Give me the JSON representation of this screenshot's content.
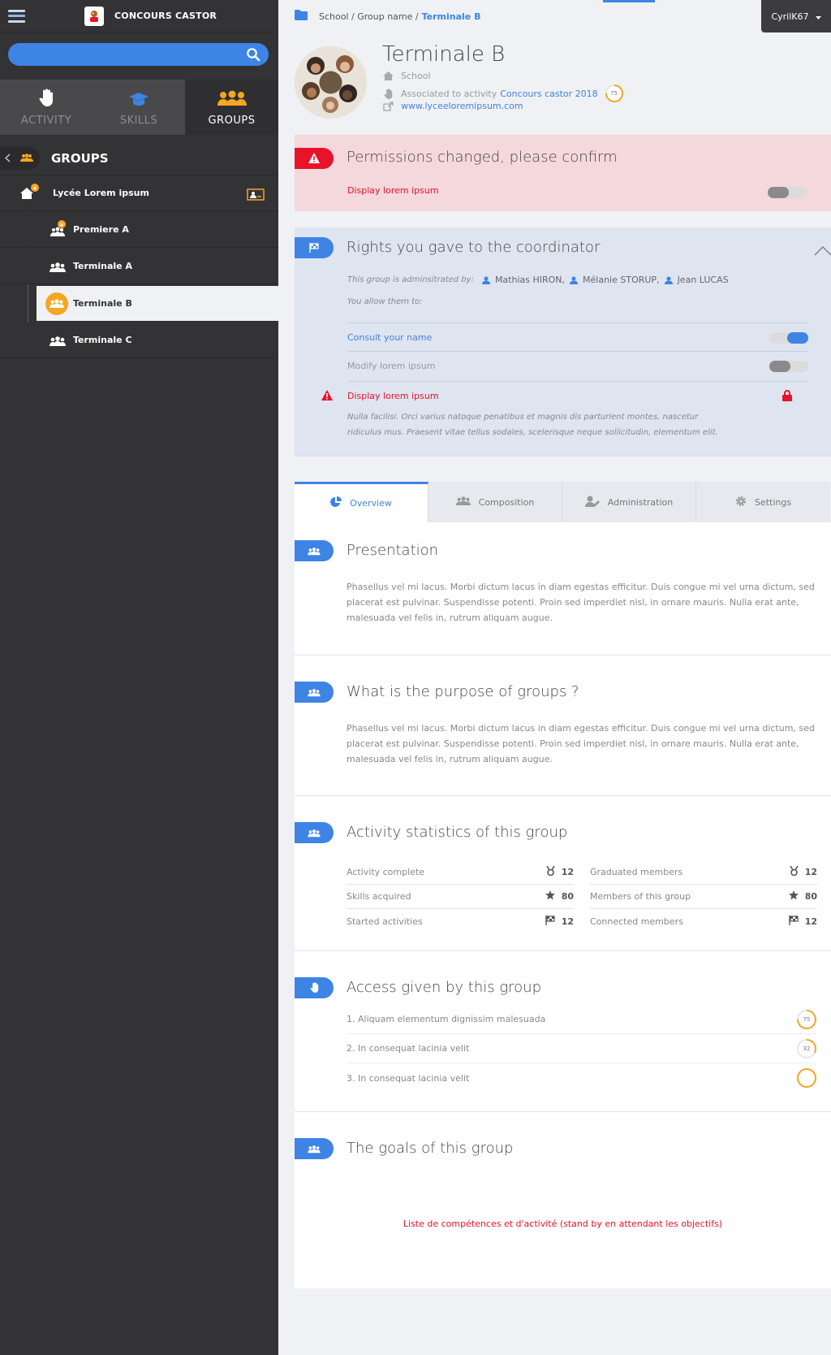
{
  "colors": {
    "accent": "#3d84e5",
    "danger": "#e8132b",
    "orange": "#f5a623",
    "sidebar": "#333335"
  },
  "sidebar": {
    "brand": "CONCOURS CASTOR",
    "search": {
      "placeholder": ""
    },
    "modes": [
      {
        "label": "ACTIVITY",
        "icon": "hand-icon"
      },
      {
        "label": "SKILLS",
        "icon": "graduation-cap-icon"
      },
      {
        "label": "GROUPS",
        "icon": "group-icon",
        "active": true
      }
    ],
    "groups_title": "GROUPS",
    "tree": [
      {
        "label": "Lycée Lorem ipsum",
        "icon": "school-icon"
      },
      {
        "label": "Premiere A",
        "icon": "users-icon"
      },
      {
        "label": "Terminale A",
        "icon": "users-icon"
      },
      {
        "label": "Terminale B",
        "icon": "users-icon",
        "selected": true
      },
      {
        "label": "Terminale C",
        "icon": "users-icon"
      }
    ]
  },
  "header": {
    "breadcrumb": {
      "path": "School / Group name /",
      "current": "Terminale B"
    },
    "user": "CyrilK67"
  },
  "hero": {
    "title": "Terminale B",
    "type": "School",
    "activity_prefix": "Associated to activity",
    "activity_link": "Concours castor 2018",
    "activity_score": "75",
    "website": "www.lyceeloremipsum.com"
  },
  "alert": {
    "title": "Permissions changed, please confirm",
    "item": "Display lorem ipsum",
    "toggle_on": false
  },
  "rights": {
    "title": "Rights you gave to the coordinator",
    "admin_prefix": "This group is adminsitrated by:",
    "admins": [
      "Mathias HIRON,",
      "Mélanie STORUP,",
      "Jean LUCAS"
    ],
    "allow_text": "You allow them to:",
    "items": [
      {
        "label": "Consult your name",
        "state": "on"
      },
      {
        "label": "Modify lorem ipsum",
        "state": "off"
      },
      {
        "label": "Display lorem ipsum",
        "state": "locked"
      }
    ],
    "note": "Nulla facilisi. Orci varius natoque penatibus et magnis dis parturient montes, nascetur ridiculus mus. Praesent vitae tellus sodales, scelerisque neque sollicitudin, elementum elit."
  },
  "tabs": [
    {
      "label": "Overview",
      "active": true
    },
    {
      "label": "Composition"
    },
    {
      "label": "Administration"
    },
    {
      "label": "Settings"
    }
  ],
  "presentation": {
    "title": "Presentation",
    "text": "Phasellus vel mi lacus. Morbi dictum lacus in diam egestas efficitur. Duis congue mi vel urna dictum, sed placerat est pulvinar. Suspendisse potenti. Proin sed imperdiet nisl, in ornare mauris. Nulla erat ante, malesuada vel felis in, rutrum aliquam augue."
  },
  "purpose": {
    "title": "What is the purpose of groups ?",
    "text": "Phasellus vel mi lacus. Morbi dictum lacus in diam egestas efficitur. Duis congue mi vel urna dictum, sed placerat est pulvinar. Suspendisse potenti. Proin sed imperdiet nisl, in ornare mauris. Nulla erat ante, malesuada vel felis in, rutrum aliquam augue."
  },
  "stats": {
    "title": "Activity statistics of this group",
    "left": [
      {
        "label": "Activity complete",
        "value": "12",
        "icon": "medal-icon"
      },
      {
        "label": "Skills acquired",
        "value": "80",
        "icon": "star-icon"
      },
      {
        "label": "Started activities",
        "value": "12",
        "icon": "flag-icon"
      }
    ],
    "right": [
      {
        "label": "Graduated members",
        "value": "12",
        "icon": "medal-icon"
      },
      {
        "label": "Members of this group",
        "value": "80",
        "icon": "star-icon"
      },
      {
        "label": "Connected members",
        "value": "12",
        "icon": "flag-icon"
      }
    ]
  },
  "access": {
    "title": "Access given by this group",
    "items": [
      {
        "label": "1. Aliquam elementum dignissim malesuada",
        "score": "75",
        "fill": 0.75
      },
      {
        "label": "2. In consequat lacinia velit",
        "score": "32",
        "fill": 0.32
      },
      {
        "label": "3. In consequat lacinia velit",
        "score": "",
        "fill": 1.0
      }
    ]
  },
  "goals": {
    "title": "The goals of this group",
    "note": "Liste de compétences et d'activité (stand by en attendant les objectifs)"
  }
}
